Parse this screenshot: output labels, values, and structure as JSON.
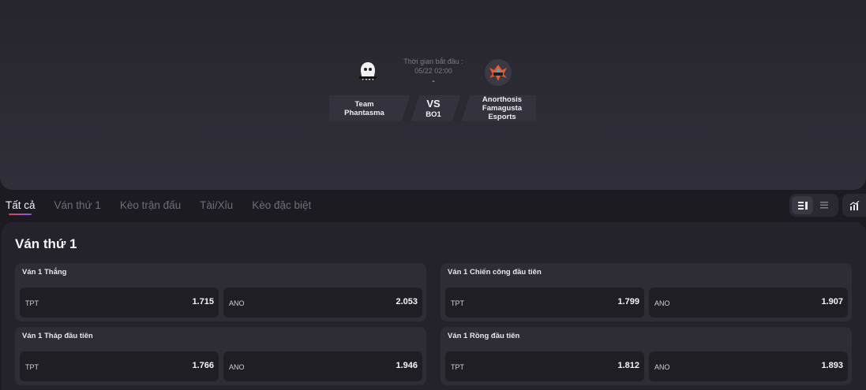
{
  "match": {
    "team_home": "Team Phantasma",
    "team_away": "Anorthosis Famagusta Esports",
    "start_label": "Thời gian bắt đầu :",
    "start_time": "05/22 02:00",
    "score": "-",
    "vs": "VS",
    "format": "BO1"
  },
  "tabs": [
    {
      "label": "Tất cả",
      "active": true
    },
    {
      "label": "Ván thứ 1",
      "active": false
    },
    {
      "label": "Kèo trận đấu",
      "active": false
    },
    {
      "label": "Tài/Xỉu",
      "active": false
    },
    {
      "label": "Kèo đặc biệt",
      "active": false
    }
  ],
  "section": {
    "title": "Ván thứ 1"
  },
  "markets": [
    {
      "title": "Ván 1 Thắng",
      "odds": [
        {
          "label": "TPT",
          "value": "1.715"
        },
        {
          "label": "ANO",
          "value": "2.053"
        }
      ]
    },
    {
      "title": "Ván 1 Chiến công đầu tiên",
      "odds": [
        {
          "label": "TPT",
          "value": "1.799"
        },
        {
          "label": "ANO",
          "value": "1.907"
        }
      ]
    },
    {
      "title": "Ván 1 Tháp đầu tiên",
      "odds": [
        {
          "label": "TPT",
          "value": "1.766"
        },
        {
          "label": "ANO",
          "value": "1.946"
        }
      ]
    },
    {
      "title": "Ván 1 Rồng đầu tiên",
      "odds": [
        {
          "label": "TPT",
          "value": "1.812"
        },
        {
          "label": "ANO",
          "value": "1.893"
        }
      ]
    }
  ],
  "icons": {
    "home_logo": "ghost-team-logo-icon",
    "away_logo": "phoenix-team-logo-icon",
    "view_card": "card-view-icon",
    "view_list": "list-view-icon",
    "stats": "chart-stats-icon"
  },
  "colors": {
    "tab_indicator_start": "#e04545",
    "tab_indicator_end": "#8a53ff"
  }
}
